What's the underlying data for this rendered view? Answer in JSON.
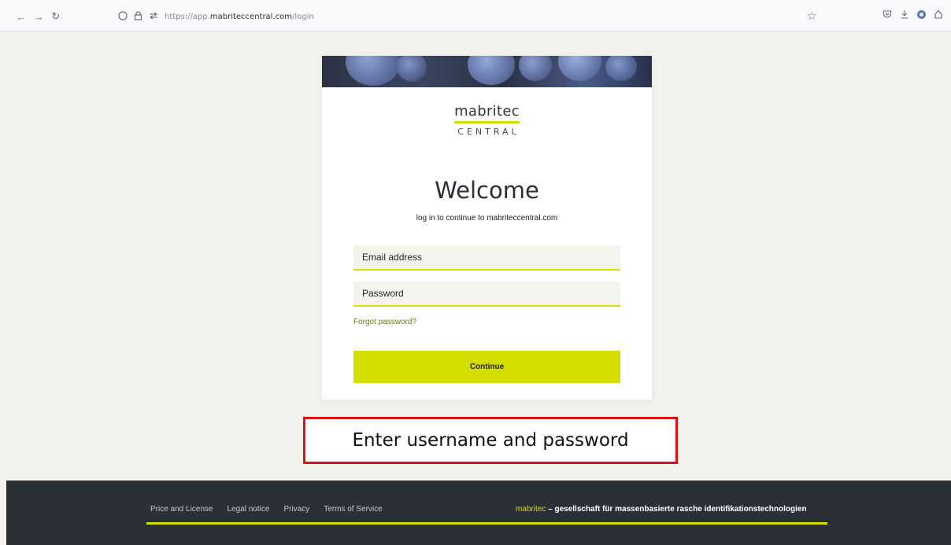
{
  "browser": {
    "back_icon": "←",
    "forward_icon": "→",
    "reload_icon": "↻",
    "url_prefix": "https://app.",
    "url_host": "mabriteccentral.com",
    "url_path": "/login"
  },
  "login": {
    "logo_main": "mabritec",
    "logo_sub": "CENTRAL",
    "title": "Welcome",
    "subtitle": "log in to continue to mabriteccentral.com",
    "email_placeholder": "Email address",
    "password_placeholder": "Password",
    "forgot_link": "Forgot password?",
    "continue_label": "Continue"
  },
  "annotation": {
    "text": "Enter username and password"
  },
  "footer": {
    "links": [
      "Price and License",
      "Legal notice",
      "Privacy",
      "Terms of Service"
    ],
    "brand": "mabritec",
    "tagline": " – gesellschaft für massenbasierte rasche identifikationstechnologien"
  },
  "colors": {
    "accent": "#d4df00",
    "footer_bg": "#2b2f36",
    "annotation_border": "#e01010"
  }
}
